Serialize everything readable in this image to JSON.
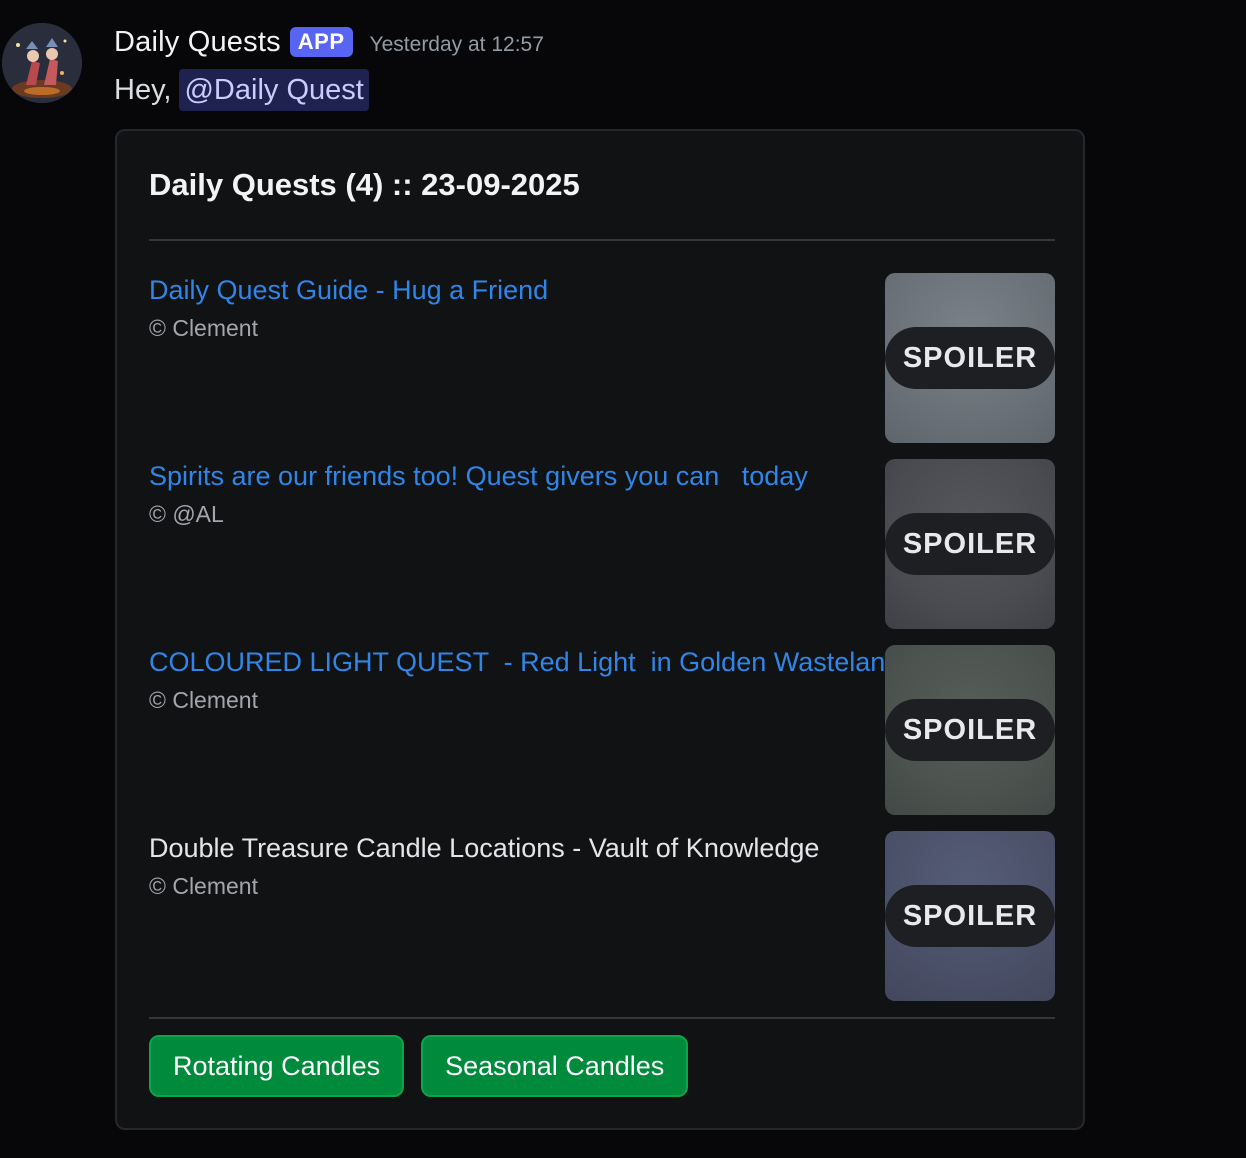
{
  "message": {
    "author": "Daily Quests",
    "badge": "APP",
    "timestamp": "Yesterday at 12:57",
    "greeting": "Hey,",
    "mention": "@Daily Quest"
  },
  "embed": {
    "title": "Daily Quests (4) :: 23-09-2025",
    "quests": [
      {
        "title": "Daily Quest Guide - Hug a Friend",
        "author": "© Clement",
        "is_link": true,
        "spoiler_label": "SPOILER",
        "thumb_color": "#6a7178"
      },
      {
        "title": "Spirits are our friends too! Quest givers you can   today",
        "author": "© @AL",
        "is_link": true,
        "spoiler_label": "SPOILER",
        "thumb_color": "#4b4c52"
      },
      {
        "title": "COLOURED LIGHT QUEST  - Red Light  in Golden Wasteland",
        "author": "© Clement",
        "is_link": true,
        "spoiler_label": "SPOILER",
        "thumb_color": "#4c534f"
      },
      {
        "title": "Double Treasure Candle Locations - Vault of Knowledge",
        "author": "© Clement",
        "is_link": false,
        "spoiler_label": "SPOILER",
        "thumb_color": "#4a5068"
      }
    ],
    "buttons": [
      {
        "label": "Rotating Candles"
      },
      {
        "label": "Seasonal Candles"
      }
    ]
  },
  "colors": {
    "background": "#070709",
    "embed_background": "#111214",
    "link": "#2f86e8",
    "app_badge": "#5865f2",
    "button_green": "#008a3b"
  }
}
